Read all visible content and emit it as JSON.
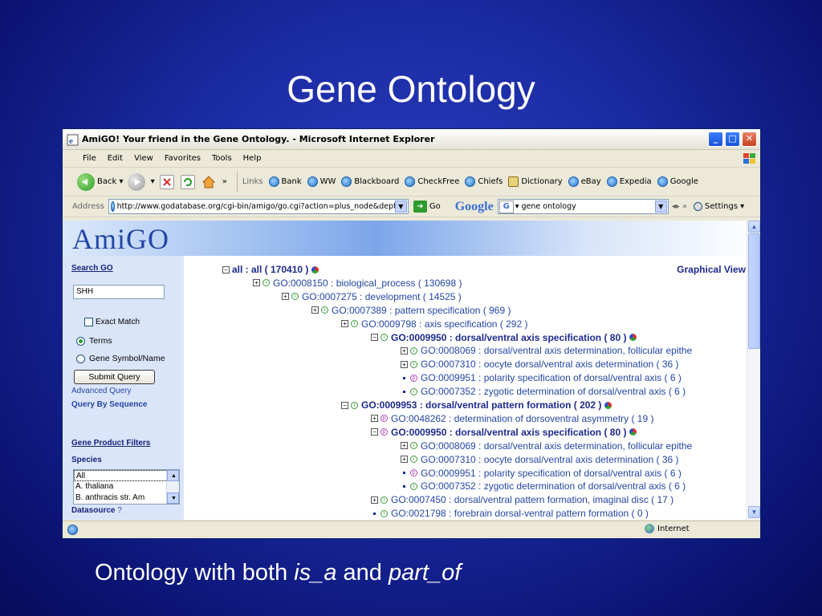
{
  "slide": {
    "title": "Gene Ontology",
    "caption_prefix": "Ontology with both ",
    "caption_is_a": "is_a",
    "caption_and": " and ",
    "caption_part_of": "part_of"
  },
  "browser": {
    "title": "AmiGO! Your friend in the Gene Ontology. - Microsoft Internet Explorer",
    "menu": [
      "File",
      "Edit",
      "View",
      "Favorites",
      "Tools",
      "Help"
    ],
    "toolbar": {
      "back": "Back",
      "links_label": "Links"
    },
    "links": [
      "Bank",
      "WW",
      "Blackboard",
      "CheckFree",
      "Chiefs",
      "Dictionary",
      "eBay",
      "Expedia",
      "Google"
    ],
    "address_label": "Address",
    "address_value": "http://www.godatabase.org/cgi-bin/amigo/go.cgi?action=plus_node&depth=",
    "go_label": "Go",
    "google_logo": "Google",
    "search_value": "gene ontology",
    "settings_label": "Settings",
    "status_zone": "Internet"
  },
  "amigo": {
    "logo": "AmiGO",
    "sidebar": {
      "search_heading": "Search GO",
      "search_value": "SHH",
      "exact_match": "Exact Match",
      "terms": "Terms",
      "gene_symbol": "Gene Symbol/Name",
      "submit": "Submit Query",
      "advanced": "Advanced Query",
      "by_sequence": "Query By Sequence",
      "filters_heading": "Gene Product Filters",
      "species_label": "Species",
      "species": [
        "All",
        "A. thaliana",
        "B. anthracis str. Am"
      ],
      "datasource_label": "Datasource",
      "datasource_help": "?"
    },
    "graphical_view": "Graphical View",
    "tree": [
      {
        "text": "all : all ( 170410 )",
        "ctrl": "minus",
        "rel": "",
        "pie": true,
        "style": "root"
      },
      {
        "text": "GO:0008150 : biological_process ( 130698 )",
        "ctrl": "plus",
        "rel": "i",
        "pie": false,
        "style": ""
      },
      {
        "text": "GO:0007275 : development ( 14525 )",
        "ctrl": "plus",
        "rel": "i",
        "pie": false,
        "style": ""
      },
      {
        "text": "GO:0007389 : pattern specification ( 969 )",
        "ctrl": "plus",
        "rel": "i",
        "pie": false,
        "style": ""
      },
      {
        "text": "GO:0009798 : axis specification ( 292 )",
        "ctrl": "plus",
        "rel": "i",
        "pie": false,
        "style": ""
      },
      {
        "text": "GO:0009950 : dorsal/ventral axis specification ( 80 )",
        "ctrl": "minus",
        "rel": "i",
        "pie": true,
        "style": "bold"
      },
      {
        "text": "GO:0008069 : dorsal/ventral axis determination, follicular epithe",
        "ctrl": "plus",
        "rel": "i",
        "pie": false,
        "style": ""
      },
      {
        "text": "GO:0007310 : oocyte dorsal/ventral axis determination ( 36 )",
        "ctrl": "plus",
        "rel": "i",
        "pie": false,
        "style": ""
      },
      {
        "text": "GO:0009951 : polarity specification of dorsal/ventral axis ( 6 )",
        "ctrl": "bullet",
        "rel": "p",
        "pie": false,
        "style": ""
      },
      {
        "text": "GO:0007352 : zygotic determination of dorsal/ventral axis ( 6 )",
        "ctrl": "bullet",
        "rel": "i",
        "pie": false,
        "style": ""
      },
      {
        "text": "GO:0009953 : dorsal/ventral pattern formation ( 202 )",
        "ctrl": "minus",
        "rel": "i",
        "pie": true,
        "style": "bold"
      },
      {
        "text": "GO:0048262 : determination of dorsoventral asymmetry ( 19 )",
        "ctrl": "plus",
        "rel": "p",
        "pie": false,
        "style": ""
      },
      {
        "text": "GO:0009950 : dorsal/ventral axis specification ( 80 )",
        "ctrl": "minus",
        "rel": "p",
        "pie": true,
        "style": "bold"
      },
      {
        "text": "GO:0008069 : dorsal/ventral axis determination, follicular epithe",
        "ctrl": "plus",
        "rel": "i",
        "pie": false,
        "style": ""
      },
      {
        "text": "GO:0007310 : oocyte dorsal/ventral axis determination ( 36 )",
        "ctrl": "plus",
        "rel": "i",
        "pie": false,
        "style": ""
      },
      {
        "text": "GO:0009951 : polarity specification of dorsal/ventral axis ( 6 )",
        "ctrl": "bullet",
        "rel": "p",
        "pie": false,
        "style": ""
      },
      {
        "text": "GO:0007352 : zygotic determination of dorsal/ventral axis ( 6 )",
        "ctrl": "bullet",
        "rel": "i",
        "pie": false,
        "style": ""
      },
      {
        "text": "GO:0007450 : dorsal/ventral pattern formation, imaginal disc ( 17 )",
        "ctrl": "plus",
        "rel": "i",
        "pie": false,
        "style": ""
      },
      {
        "text": "GO:0021798 : forebrain dorsal-ventral pattern formation ( 0 )",
        "ctrl": "bullet",
        "rel": "i",
        "pie": false,
        "style": ""
      }
    ]
  },
  "colors": {
    "slide_bg": "#1a2aa0",
    "link": "#2446a6",
    "bold_term": "#1d2a8f",
    "is_a": "#3d9b3d",
    "part_of": "#b24ab9"
  }
}
